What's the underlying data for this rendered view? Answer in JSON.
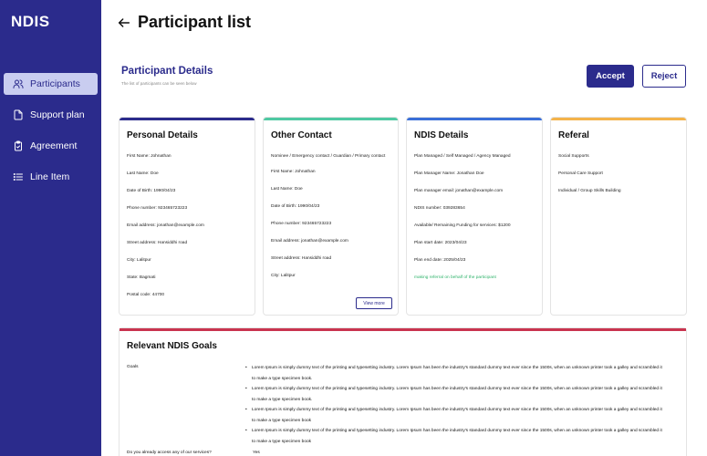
{
  "app": {
    "brand": "NDIS"
  },
  "sidebar": {
    "items": [
      {
        "label": "Participants",
        "icon": "users-icon",
        "active": true
      },
      {
        "label": "Support plan",
        "icon": "document-icon",
        "active": false
      },
      {
        "label": "Agreement",
        "icon": "clipboard-check-icon",
        "active": false
      },
      {
        "label": "Line Item",
        "icon": "list-icon",
        "active": false
      }
    ]
  },
  "header": {
    "title": "Participant list"
  },
  "details": {
    "title": "Participant Details",
    "subtitle": "The list of participants can be seen below",
    "accept_label": "Accept",
    "reject_label": "Reject"
  },
  "cards": {
    "personal": {
      "title": "Personal Details",
      "color": "#2b2b8c",
      "rows": [
        "First Name: Johnathan",
        "Last Name: Doe",
        "Date of Birth: 1990/04/23",
        "Phone number: 923465723223",
        "Email address: jonathan@example.com",
        "Street address: Hansiddhi road",
        "City: Lalitpur",
        "State: Bagmati",
        "Postal code: 44700"
      ]
    },
    "other": {
      "title": "Other Contact",
      "color": "#4fc9a2",
      "rows": [
        "Nominee / Emergency contact / Guardian / Primary contact",
        "First Name: Johnathan",
        "Last Name: Doe",
        "Date of Birth: 1990/04/23",
        "Phone number: 923465723223",
        "Email address: jonathan@example.com",
        "Street address: Hansiddhi road",
        "City: Lalitpur"
      ],
      "view_more": "View more"
    },
    "ndis": {
      "title": "NDIS Details",
      "color": "#3a6fd8",
      "rows": [
        "Plan Managed / Self Managed / Agency Managed",
        "Plan Manager Name: Jonathan Doe",
        "Plan manager email: jonathan@example.com",
        "NDIS number: 039283654",
        "Available/ Remaining Funding for services: $1200",
        "Plan start date: 2023/04/23",
        "Plan end date: 2025/04/23"
      ],
      "note": "making referral on behalf of the participant"
    },
    "referal": {
      "title": "Referal",
      "color": "#f4b34a",
      "rows": [
        "Social Supports",
        "Personal Care Support",
        "Individual / Group Skills Building"
      ]
    }
  },
  "goals": {
    "title": "Relevant NDIS Goals",
    "label": "Goals",
    "items": [
      "Lorem Ipsum is simply dummy text of the printing and typesetting industry. Lorem Ipsum has been the industry's standard dummy text ever since the 1500s, when an unknown printer took a galley and scrambled it to make a type specimen book.",
      "Lorem Ipsum is simply dummy text of the printing and typesetting industry. Lorem Ipsum has been the industry's standard dummy text ever since the 1500s, when an unknown printer took a galley and scrambled it to make a type specimen book.",
      "Lorem Ipsum is simply dummy text of the printing and typesetting industry. Lorem Ipsum has been the industry's standard dummy text ever since the 1500s, when an unknown printer took a galley and scrambled it to make a type specimen book",
      "Lorem Ipsum is simply dummy text of the printing and typesetting industry. Lorem Ipsum has been the industry's standard dummy text ever since the 1500s, when an unknown printer took a galley and scrambled it to make a type specimen book"
    ],
    "question": "Do you already access any of our services?",
    "answer": "Yes"
  }
}
